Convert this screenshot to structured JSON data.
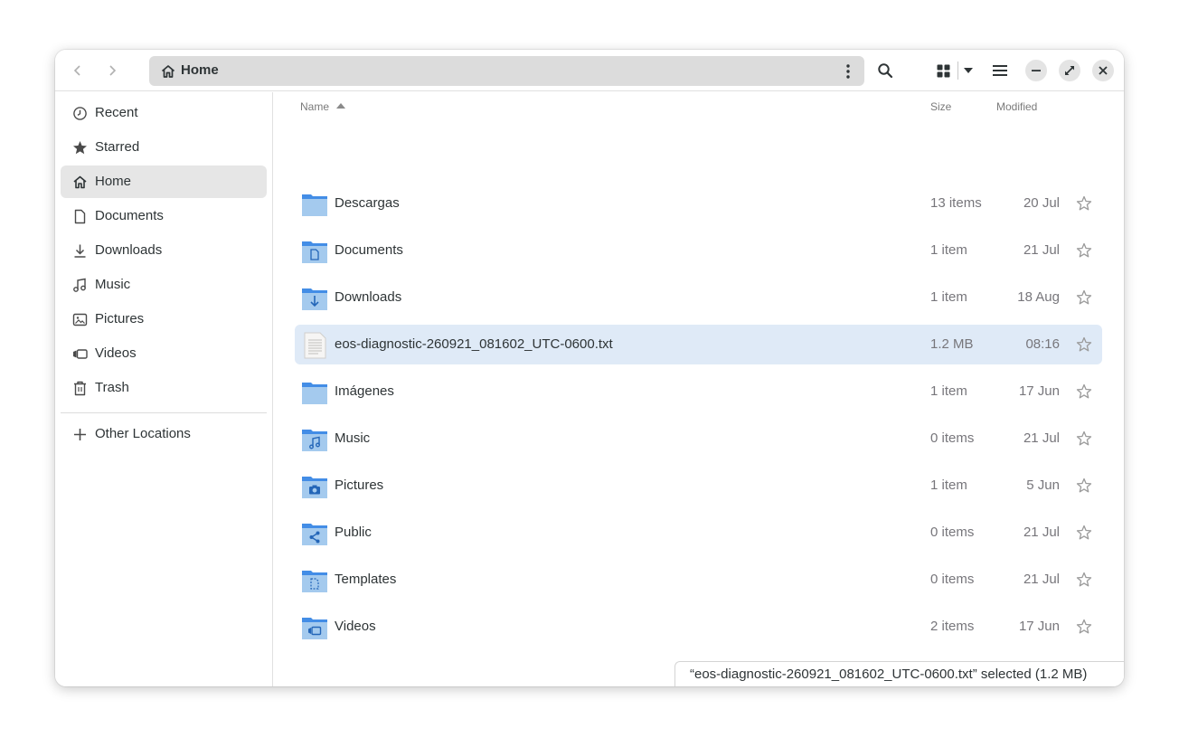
{
  "header": {
    "path_label": "Home"
  },
  "sidebar": {
    "items": [
      {
        "label": "Recent",
        "icon": "clock-icon"
      },
      {
        "label": "Starred",
        "icon": "star-icon"
      },
      {
        "label": "Home",
        "icon": "home-icon",
        "active": true
      },
      {
        "label": "Documents",
        "icon": "document-icon"
      },
      {
        "label": "Downloads",
        "icon": "download-icon"
      },
      {
        "label": "Music",
        "icon": "music-icon"
      },
      {
        "label": "Pictures",
        "icon": "picture-icon"
      },
      {
        "label": "Videos",
        "icon": "video-icon"
      },
      {
        "label": "Trash",
        "icon": "trash-icon"
      }
    ],
    "other_locations": "Other Locations"
  },
  "list": {
    "columns": {
      "name": "Name",
      "size": "Size",
      "modified": "Modified"
    },
    "rows": [
      {
        "name": "Descargas",
        "size": "13 items",
        "modified": "20 Jul",
        "type": "folder"
      },
      {
        "name": "Documents",
        "size": "1 item",
        "modified": "21 Jul",
        "type": "folder-documents"
      },
      {
        "name": "Downloads",
        "size": "1 item",
        "modified": "18 Aug",
        "type": "folder-downloads"
      },
      {
        "name": "eos-diagnostic-260921_081602_UTC-0600.txt",
        "size": "1.2 MB",
        "modified": "08:16",
        "type": "text-file",
        "selected": true
      },
      {
        "name": "Imágenes",
        "size": "1 item",
        "modified": "17 Jun",
        "type": "folder"
      },
      {
        "name": "Music",
        "size": "0 items",
        "modified": "21 Jul",
        "type": "folder-music"
      },
      {
        "name": "Pictures",
        "size": "1 item",
        "modified": "5 Jun",
        "type": "folder-pictures"
      },
      {
        "name": "Public",
        "size": "0 items",
        "modified": "21 Jul",
        "type": "folder-public"
      },
      {
        "name": "Templates",
        "size": "0 items",
        "modified": "21 Jul",
        "type": "folder-templates"
      },
      {
        "name": "Videos",
        "size": "2 items",
        "modified": "17 Jun",
        "type": "folder-videos"
      }
    ]
  },
  "status": {
    "text": "“eos-diagnostic-260921_081602_UTC-0600.txt” selected  (1.2 MB)"
  },
  "colors": {
    "folder_blue": "#438de6",
    "folder_light": "#a4caee",
    "selection": "#dfeaf7"
  }
}
